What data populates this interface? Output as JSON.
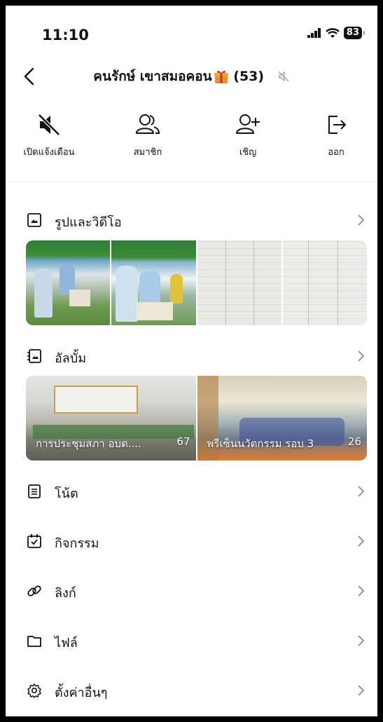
{
  "status": {
    "time": "11:10",
    "battery": "83"
  },
  "header": {
    "title": "คนรักษ์ เขาสมอคอน",
    "count": "(53)"
  },
  "actions": [
    {
      "label": "เปิดแจ้งเตือน"
    },
    {
      "label": "สมาชิก"
    },
    {
      "label": "เชิญ"
    },
    {
      "label": "ออก"
    }
  ],
  "sections": {
    "photos": {
      "label": "รูปและวิดีโอ"
    },
    "albums": {
      "label": "อัลบั้ม",
      "items": [
        {
          "name": "การประชุมสภา อบต....",
          "count": "67"
        },
        {
          "name": "พรีเซ็นนวัตกรรม รอบ 3",
          "count": "26"
        }
      ]
    },
    "notes": {
      "label": "โน้ต"
    },
    "events": {
      "label": "กิจกรรม"
    },
    "links": {
      "label": "ลิงก์"
    },
    "files": {
      "label": "ไฟล์"
    },
    "settings": {
      "label": "ตั้งค่าอื่นๆ"
    }
  },
  "colors": {
    "background": "#ffffff",
    "text": "#111111",
    "chevron": "#8a8a8a"
  }
}
